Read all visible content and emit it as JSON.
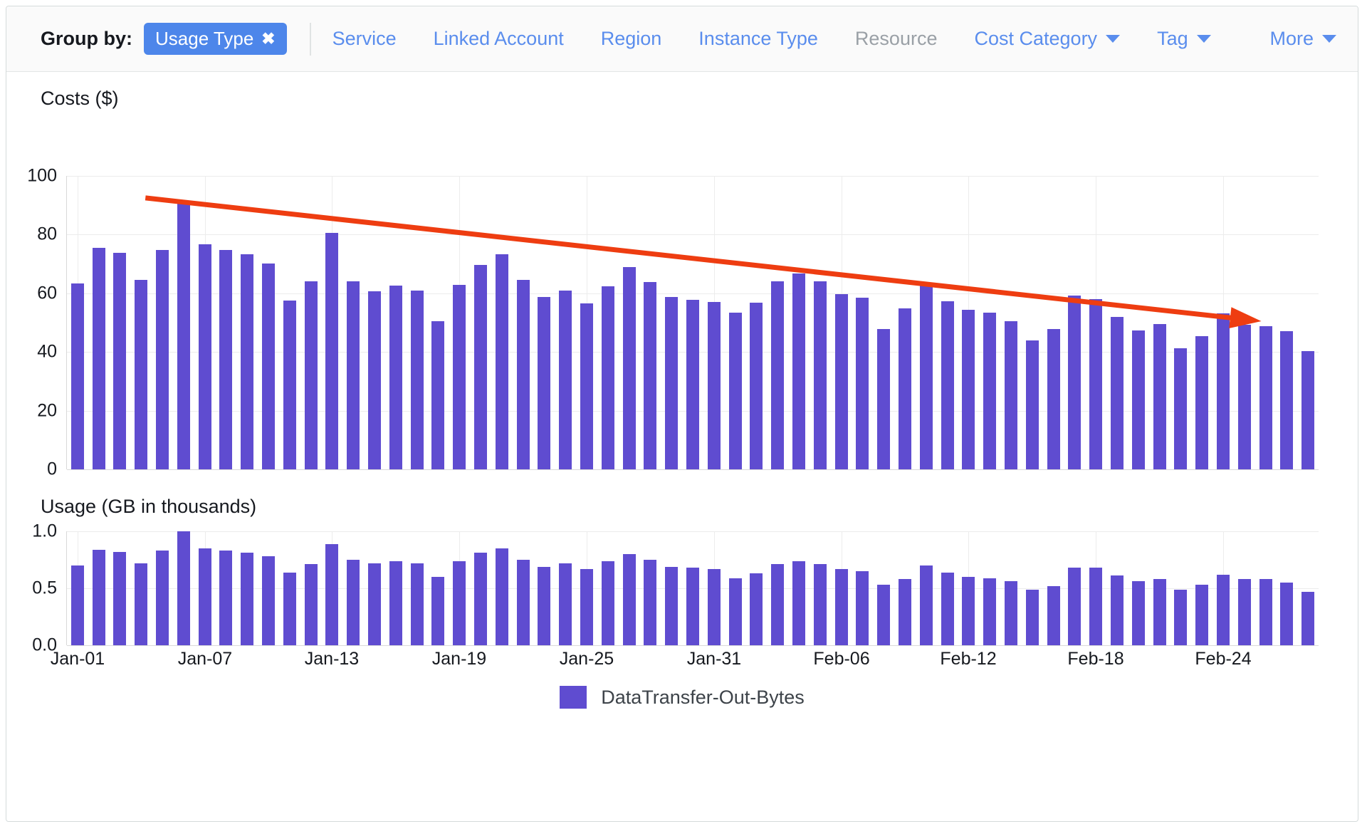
{
  "toolbar": {
    "group_by_label": "Group by:",
    "active_chip": {
      "label": "Usage Type",
      "remove_icon": "✖"
    },
    "links": [
      {
        "label": "Service",
        "state": "enabled",
        "caret": false
      },
      {
        "label": "Linked Account",
        "state": "enabled",
        "caret": false
      },
      {
        "label": "Region",
        "state": "enabled",
        "caret": false
      },
      {
        "label": "Instance Type",
        "state": "enabled",
        "caret": false
      },
      {
        "label": "Resource",
        "state": "disabled",
        "caret": false
      },
      {
        "label": "Cost Category",
        "state": "enabled",
        "caret": true
      },
      {
        "label": "Tag",
        "state": "enabled",
        "caret": true
      }
    ],
    "more": {
      "label": "More",
      "caret": true
    }
  },
  "legend": {
    "series_name": "DataTransfer-Out-Bytes",
    "swatch_color": "#5f4cd0"
  },
  "colors": {
    "bar": "#5f4cd0",
    "trend_line": "#ee3d11",
    "chip": "#4d86ea",
    "link": "#5a8ded",
    "disabled_link": "#9aa0a6",
    "grid": "#ececec"
  },
  "chart_data": [
    {
      "type": "bar",
      "id": "costs",
      "title": "Costs ($)",
      "xlabel": "",
      "ylabel": "Costs ($)",
      "ylim": [
        0,
        100
      ],
      "yticks": [
        0,
        20,
        40,
        60,
        80,
        100
      ],
      "ytick_labels": [
        "0",
        "20",
        "40",
        "60",
        "80",
        "100"
      ],
      "grid": true,
      "legend_position": "bottom",
      "x": [
        "Jan-01",
        "Jan-02",
        "Jan-03",
        "Jan-04",
        "Jan-05",
        "Jan-06",
        "Jan-07",
        "Jan-08",
        "Jan-09",
        "Jan-10",
        "Jan-11",
        "Jan-12",
        "Jan-13",
        "Jan-14",
        "Jan-15",
        "Jan-16",
        "Jan-17",
        "Jan-18",
        "Jan-19",
        "Jan-20",
        "Jan-21",
        "Jan-22",
        "Jan-23",
        "Jan-24",
        "Jan-25",
        "Jan-26",
        "Jan-27",
        "Jan-28",
        "Jan-29",
        "Jan-30",
        "Jan-31",
        "Feb-01",
        "Feb-02",
        "Feb-03",
        "Feb-04",
        "Feb-05",
        "Feb-06",
        "Feb-07",
        "Feb-08",
        "Feb-09",
        "Feb-10",
        "Feb-11",
        "Feb-12",
        "Feb-13",
        "Feb-14",
        "Feb-15",
        "Feb-16",
        "Feb-17",
        "Feb-18",
        "Feb-19",
        "Feb-20",
        "Feb-21",
        "Feb-22",
        "Feb-23",
        "Feb-24",
        "Feb-25",
        "Feb-26",
        "Feb-27",
        "Feb-28"
      ],
      "categories": [
        "Jan-01",
        "Jan-02",
        "Jan-03",
        "Jan-04",
        "Jan-05",
        "Jan-06",
        "Jan-07",
        "Jan-08",
        "Jan-09",
        "Jan-10",
        "Jan-11",
        "Jan-12",
        "Jan-13",
        "Jan-14",
        "Jan-15",
        "Jan-16",
        "Jan-17",
        "Jan-18",
        "Jan-19",
        "Jan-20",
        "Jan-21",
        "Jan-22",
        "Jan-23",
        "Jan-24",
        "Jan-25",
        "Jan-26",
        "Jan-27",
        "Jan-28",
        "Jan-29",
        "Jan-30",
        "Jan-31",
        "Feb-01",
        "Feb-02",
        "Feb-03",
        "Feb-04",
        "Feb-05",
        "Feb-06",
        "Feb-07",
        "Feb-08",
        "Feb-09",
        "Feb-10",
        "Feb-11",
        "Feb-12",
        "Feb-13",
        "Feb-14",
        "Feb-15",
        "Feb-16",
        "Feb-17",
        "Feb-18",
        "Feb-19",
        "Feb-20",
        "Feb-21",
        "Feb-22",
        "Feb-23",
        "Feb-24",
        "Feb-25",
        "Feb-26",
        "Feb-27",
        "Feb-28"
      ],
      "values": [
        63.3,
        75.5,
        73.8,
        64.5,
        74.8,
        90.5,
        76.8,
        74.7,
        73.2,
        70.2,
        57.6,
        64.1,
        80.5,
        64.0,
        60.8,
        62.7,
        60.9,
        50.5,
        62.8,
        69.7,
        73.2,
        64.5,
        58.8,
        61.0,
        56.5,
        62.3,
        68.9,
        63.9,
        58.7,
        57.7,
        57.0,
        53.3,
        56.8,
        64.2,
        66.8,
        64.0,
        59.8,
        58.4,
        47.8,
        54.8,
        62.7,
        57.3,
        54.3,
        53.5,
        50.5,
        43.9,
        47.9,
        59.2,
        57.9,
        51.9,
        47.3,
        49.6,
        41.2,
        45.4,
        53.1,
        49.3,
        48.7,
        47.2,
        40.4
      ],
      "xtick_labels": [
        "Jan-01",
        "Jan-07",
        "Jan-13",
        "Jan-19",
        "Jan-25",
        "Jan-31",
        "Feb-06",
        "Feb-12",
        "Feb-18",
        "Feb-24"
      ],
      "xtick_indices": [
        0,
        6,
        12,
        18,
        24,
        30,
        36,
        42,
        48,
        54
      ],
      "annotations": [
        {
          "type": "trend-arrow",
          "color": "#ee3d11",
          "start": {
            "x_index": 3.2,
            "y": 92.5
          },
          "end": {
            "x_index": 55.8,
            "y": 50.5
          },
          "arrowhead": "end"
        }
      ],
      "series": [
        {
          "name": "DataTransfer-Out-Bytes",
          "color": "#5f4cd0"
        }
      ]
    },
    {
      "type": "bar",
      "id": "usage",
      "title": "Usage (GB in thousands)",
      "xlabel": "",
      "ylabel": "Usage (GB in thousands)",
      "ylim": [
        0,
        1.0
      ],
      "yticks": [
        0.0,
        0.5,
        1.0
      ],
      "ytick_labels": [
        "0.0",
        "0.5",
        "1.0"
      ],
      "grid": true,
      "legend_position": "bottom",
      "categories": [
        "Jan-01",
        "Jan-02",
        "Jan-03",
        "Jan-04",
        "Jan-05",
        "Jan-06",
        "Jan-07",
        "Jan-08",
        "Jan-09",
        "Jan-10",
        "Jan-11",
        "Jan-12",
        "Jan-13",
        "Jan-14",
        "Jan-15",
        "Jan-16",
        "Jan-17",
        "Jan-18",
        "Jan-19",
        "Jan-20",
        "Jan-21",
        "Jan-22",
        "Jan-23",
        "Jan-24",
        "Jan-25",
        "Jan-26",
        "Jan-27",
        "Jan-28",
        "Jan-29",
        "Jan-30",
        "Jan-31",
        "Feb-01",
        "Feb-02",
        "Feb-03",
        "Feb-04",
        "Feb-05",
        "Feb-06",
        "Feb-07",
        "Feb-08",
        "Feb-09",
        "Feb-10",
        "Feb-11",
        "Feb-12",
        "Feb-13",
        "Feb-14",
        "Feb-15",
        "Feb-16",
        "Feb-17",
        "Feb-18",
        "Feb-19",
        "Feb-20",
        "Feb-21",
        "Feb-22",
        "Feb-23",
        "Feb-24",
        "Feb-25",
        "Feb-26",
        "Feb-27",
        "Feb-28"
      ],
      "values": [
        0.7,
        0.84,
        0.82,
        0.72,
        0.83,
        1.0,
        0.85,
        0.83,
        0.81,
        0.78,
        0.64,
        0.71,
        0.89,
        0.75,
        0.72,
        0.74,
        0.72,
        0.6,
        0.74,
        0.81,
        0.85,
        0.75,
        0.69,
        0.72,
        0.67,
        0.74,
        0.8,
        0.75,
        0.69,
        0.68,
        0.67,
        0.59,
        0.63,
        0.71,
        0.74,
        0.71,
        0.67,
        0.65,
        0.53,
        0.58,
        0.7,
        0.64,
        0.6,
        0.59,
        0.56,
        0.49,
        0.52,
        0.68,
        0.68,
        0.61,
        0.56,
        0.58,
        0.49,
        0.53,
        0.62,
        0.58,
        0.58,
        0.55,
        0.47
      ],
      "xtick_labels": [
        "Jan-01",
        "Jan-07",
        "Jan-13",
        "Jan-19",
        "Jan-25",
        "Jan-31",
        "Feb-06",
        "Feb-12",
        "Feb-18",
        "Feb-24"
      ],
      "xtick_indices": [
        0,
        6,
        12,
        18,
        24,
        30,
        36,
        42,
        48,
        54
      ],
      "series": [
        {
          "name": "DataTransfer-Out-Bytes",
          "color": "#5f4cd0"
        }
      ]
    }
  ]
}
